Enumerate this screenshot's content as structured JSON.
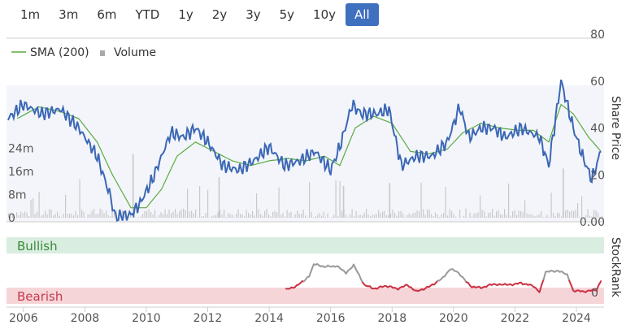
{
  "range_buttons": [
    {
      "label": "1m",
      "active": false
    },
    {
      "label": "3m",
      "active": false
    },
    {
      "label": "6m",
      "active": false
    },
    {
      "label": "YTD",
      "active": false
    },
    {
      "label": "1y",
      "active": false
    },
    {
      "label": "2y",
      "active": false
    },
    {
      "label": "3y",
      "active": false
    },
    {
      "label": "5y",
      "active": false
    },
    {
      "label": "10y",
      "active": false
    },
    {
      "label": "All",
      "active": true
    }
  ],
  "colors": {
    "price": "#3b67b5",
    "sma": "#5aab3f",
    "volume": "#c8c8c8",
    "bullish_band": "#d9ede0",
    "bearish_band": "#f6d5d8",
    "bullish_text": "#3a8a3a",
    "bearish_text": "#c23b4b",
    "rank_gray": "#9a9a9a",
    "rank_red": "#cc3344",
    "active_button": "#3f6fbf"
  },
  "chart_data": [
    {
      "type": "line",
      "title": "",
      "legend": [
        {
          "name": "SMA (200)",
          "marker": "line"
        },
        {
          "name": "Volume",
          "marker": "square"
        }
      ],
      "legend_position": "top-left",
      "right_axis_title": "Share Price",
      "x_ticks": [
        "2006",
        "2008",
        "2010",
        "2012",
        "2014",
        "2016",
        "2018",
        "2020",
        "2022",
        "2024"
      ],
      "price_ticks": [
        "80",
        "60",
        "40",
        "20",
        "0.00"
      ],
      "price_range": [
        0,
        80
      ],
      "volume_ticks": [
        "24m",
        "16m",
        "8m",
        "0"
      ],
      "volume_range": [
        0,
        32
      ],
      "series": [
        {
          "name": "Price",
          "points": [
            [
              2005.5,
              44
            ],
            [
              2006,
              50
            ],
            [
              2006.6,
              46
            ],
            [
              2007.2,
              48
            ],
            [
              2007.8,
              40
            ],
            [
              2008.4,
              28
            ],
            [
              2008.8,
              12
            ],
            [
              2009,
              2
            ],
            [
              2009.5,
              3
            ],
            [
              2009.8,
              8
            ],
            [
              2010.2,
              18
            ],
            [
              2010.8,
              38
            ],
            [
              2011.2,
              36
            ],
            [
              2011.6,
              40
            ],
            [
              2012,
              34
            ],
            [
              2012.5,
              24
            ],
            [
              2013,
              22
            ],
            [
              2013.5,
              26
            ],
            [
              2014,
              32
            ],
            [
              2014.5,
              24
            ],
            [
              2015,
              26
            ],
            [
              2015.5,
              30
            ],
            [
              2016,
              22
            ],
            [
              2016.3,
              32
            ],
            [
              2016.7,
              50
            ],
            [
              2017,
              46
            ],
            [
              2017.5,
              46
            ],
            [
              2017.9,
              48
            ],
            [
              2018.3,
              24
            ],
            [
              2018.8,
              28
            ],
            [
              2019.3,
              28
            ],
            [
              2019.8,
              34
            ],
            [
              2020.2,
              49
            ],
            [
              2020.5,
              36
            ],
            [
              2020.9,
              40
            ],
            [
              2021.3,
              40
            ],
            [
              2021.7,
              36
            ],
            [
              2022.2,
              40
            ],
            [
              2022.8,
              36
            ],
            [
              2023.1,
              24
            ],
            [
              2023.5,
              60
            ],
            [
              2023.9,
              40
            ],
            [
              2024.2,
              28
            ],
            [
              2024.5,
              18
            ],
            [
              2024.8,
              30
            ]
          ]
        },
        {
          "name": "SMA (200)",
          "points": [
            [
              2005.8,
              44
            ],
            [
              2006.5,
              49
            ],
            [
              2007.2,
              47
            ],
            [
              2007.8,
              44
            ],
            [
              2008.4,
              34
            ],
            [
              2008.9,
              20
            ],
            [
              2009.5,
              6
            ],
            [
              2010,
              6
            ],
            [
              2010.5,
              14
            ],
            [
              2011,
              28
            ],
            [
              2011.6,
              34
            ],
            [
              2012.2,
              30
            ],
            [
              2012.8,
              26
            ],
            [
              2013.4,
              24
            ],
            [
              2014,
              26
            ],
            [
              2014.6,
              27
            ],
            [
              2015.2,
              26
            ],
            [
              2015.8,
              28
            ],
            [
              2016.3,
              24
            ],
            [
              2016.8,
              40
            ],
            [
              2017.4,
              45
            ],
            [
              2018,
              42
            ],
            [
              2018.6,
              30
            ],
            [
              2019.2,
              29
            ],
            [
              2019.8,
              31
            ],
            [
              2020.3,
              38
            ],
            [
              2020.9,
              42
            ],
            [
              2021.5,
              40
            ],
            [
              2022.1,
              39
            ],
            [
              2022.6,
              39
            ],
            [
              2023.1,
              34
            ],
            [
              2023.5,
              50
            ],
            [
              2023.9,
              46
            ],
            [
              2024.4,
              36
            ],
            [
              2024.8,
              30
            ]
          ]
        }
      ]
    },
    {
      "type": "line",
      "right_axis_title": "StockRank",
      "zones": [
        "Bullish",
        "Bearish"
      ],
      "range": [
        0,
        100
      ],
      "rank_ticks": [
        "0"
      ],
      "series": [
        {
          "name": "StockRank",
          "points": [
            [
              2014.55,
              6
            ],
            [
              2014.9,
              14
            ],
            [
              2015.3,
              34
            ],
            [
              2015.45,
              60
            ],
            [
              2015.8,
              55
            ],
            [
              2016.2,
              56
            ],
            [
              2016.5,
              42
            ],
            [
              2016.75,
              58
            ],
            [
              2017.1,
              16
            ],
            [
              2017.4,
              8
            ],
            [
              2017.8,
              14
            ],
            [
              2018.2,
              8
            ],
            [
              2018.5,
              16
            ],
            [
              2018.8,
              2
            ],
            [
              2019.2,
              12
            ],
            [
              2019.6,
              28
            ],
            [
              2019.9,
              50
            ],
            [
              2020.1,
              44
            ],
            [
              2020.35,
              28
            ],
            [
              2020.6,
              12
            ],
            [
              2020.9,
              10
            ],
            [
              2021.3,
              18
            ],
            [
              2021.8,
              16
            ],
            [
              2022.2,
              20
            ],
            [
              2022.6,
              14
            ],
            [
              2022.8,
              2
            ],
            [
              2023.0,
              44
            ],
            [
              2023.4,
              46
            ],
            [
              2023.7,
              38
            ],
            [
              2023.9,
              4
            ],
            [
              2024.3,
              2
            ],
            [
              2024.65,
              6
            ],
            [
              2024.8,
              24
            ]
          ]
        }
      ]
    }
  ]
}
